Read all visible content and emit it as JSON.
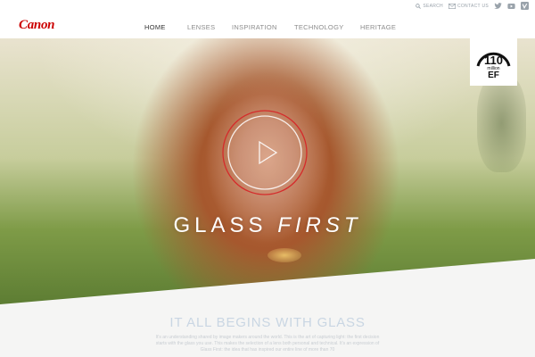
{
  "header": {
    "logo": "Canon",
    "utility": {
      "search_label": "SEARCH",
      "contact_label": "CONTACT US"
    },
    "social": [
      "twitter-icon",
      "youtube-icon",
      "vimeo-icon"
    ],
    "nav": [
      {
        "label": "HOME",
        "active": true
      },
      {
        "label": "LENSES",
        "active": false
      },
      {
        "label": "INSPIRATION",
        "active": false
      },
      {
        "label": "TECHNOLOGY",
        "active": false
      },
      {
        "label": "HERITAGE",
        "active": false
      }
    ]
  },
  "hero": {
    "title_part1": "GLASS ",
    "title_part2": "FIRST",
    "badge": {
      "number": "110",
      "unit": "million",
      "mark": "EF"
    }
  },
  "section": {
    "title": "IT ALL BEGINS WITH GLASS",
    "body": "It's an understanding shared by image makers around the world. This is the art of capturing light: the first decision starts with the glass you use. This makes the selection of a lens both personal and technical. It's an expression of Glass First: the idea that has inspired our entire line of more than 70"
  },
  "colors": {
    "brand_red": "#cc0000",
    "play_ring": "#d52b2b",
    "section_title": "#c9d6e3",
    "nav_text": "#8c8c8c",
    "nav_active": "#333333"
  }
}
